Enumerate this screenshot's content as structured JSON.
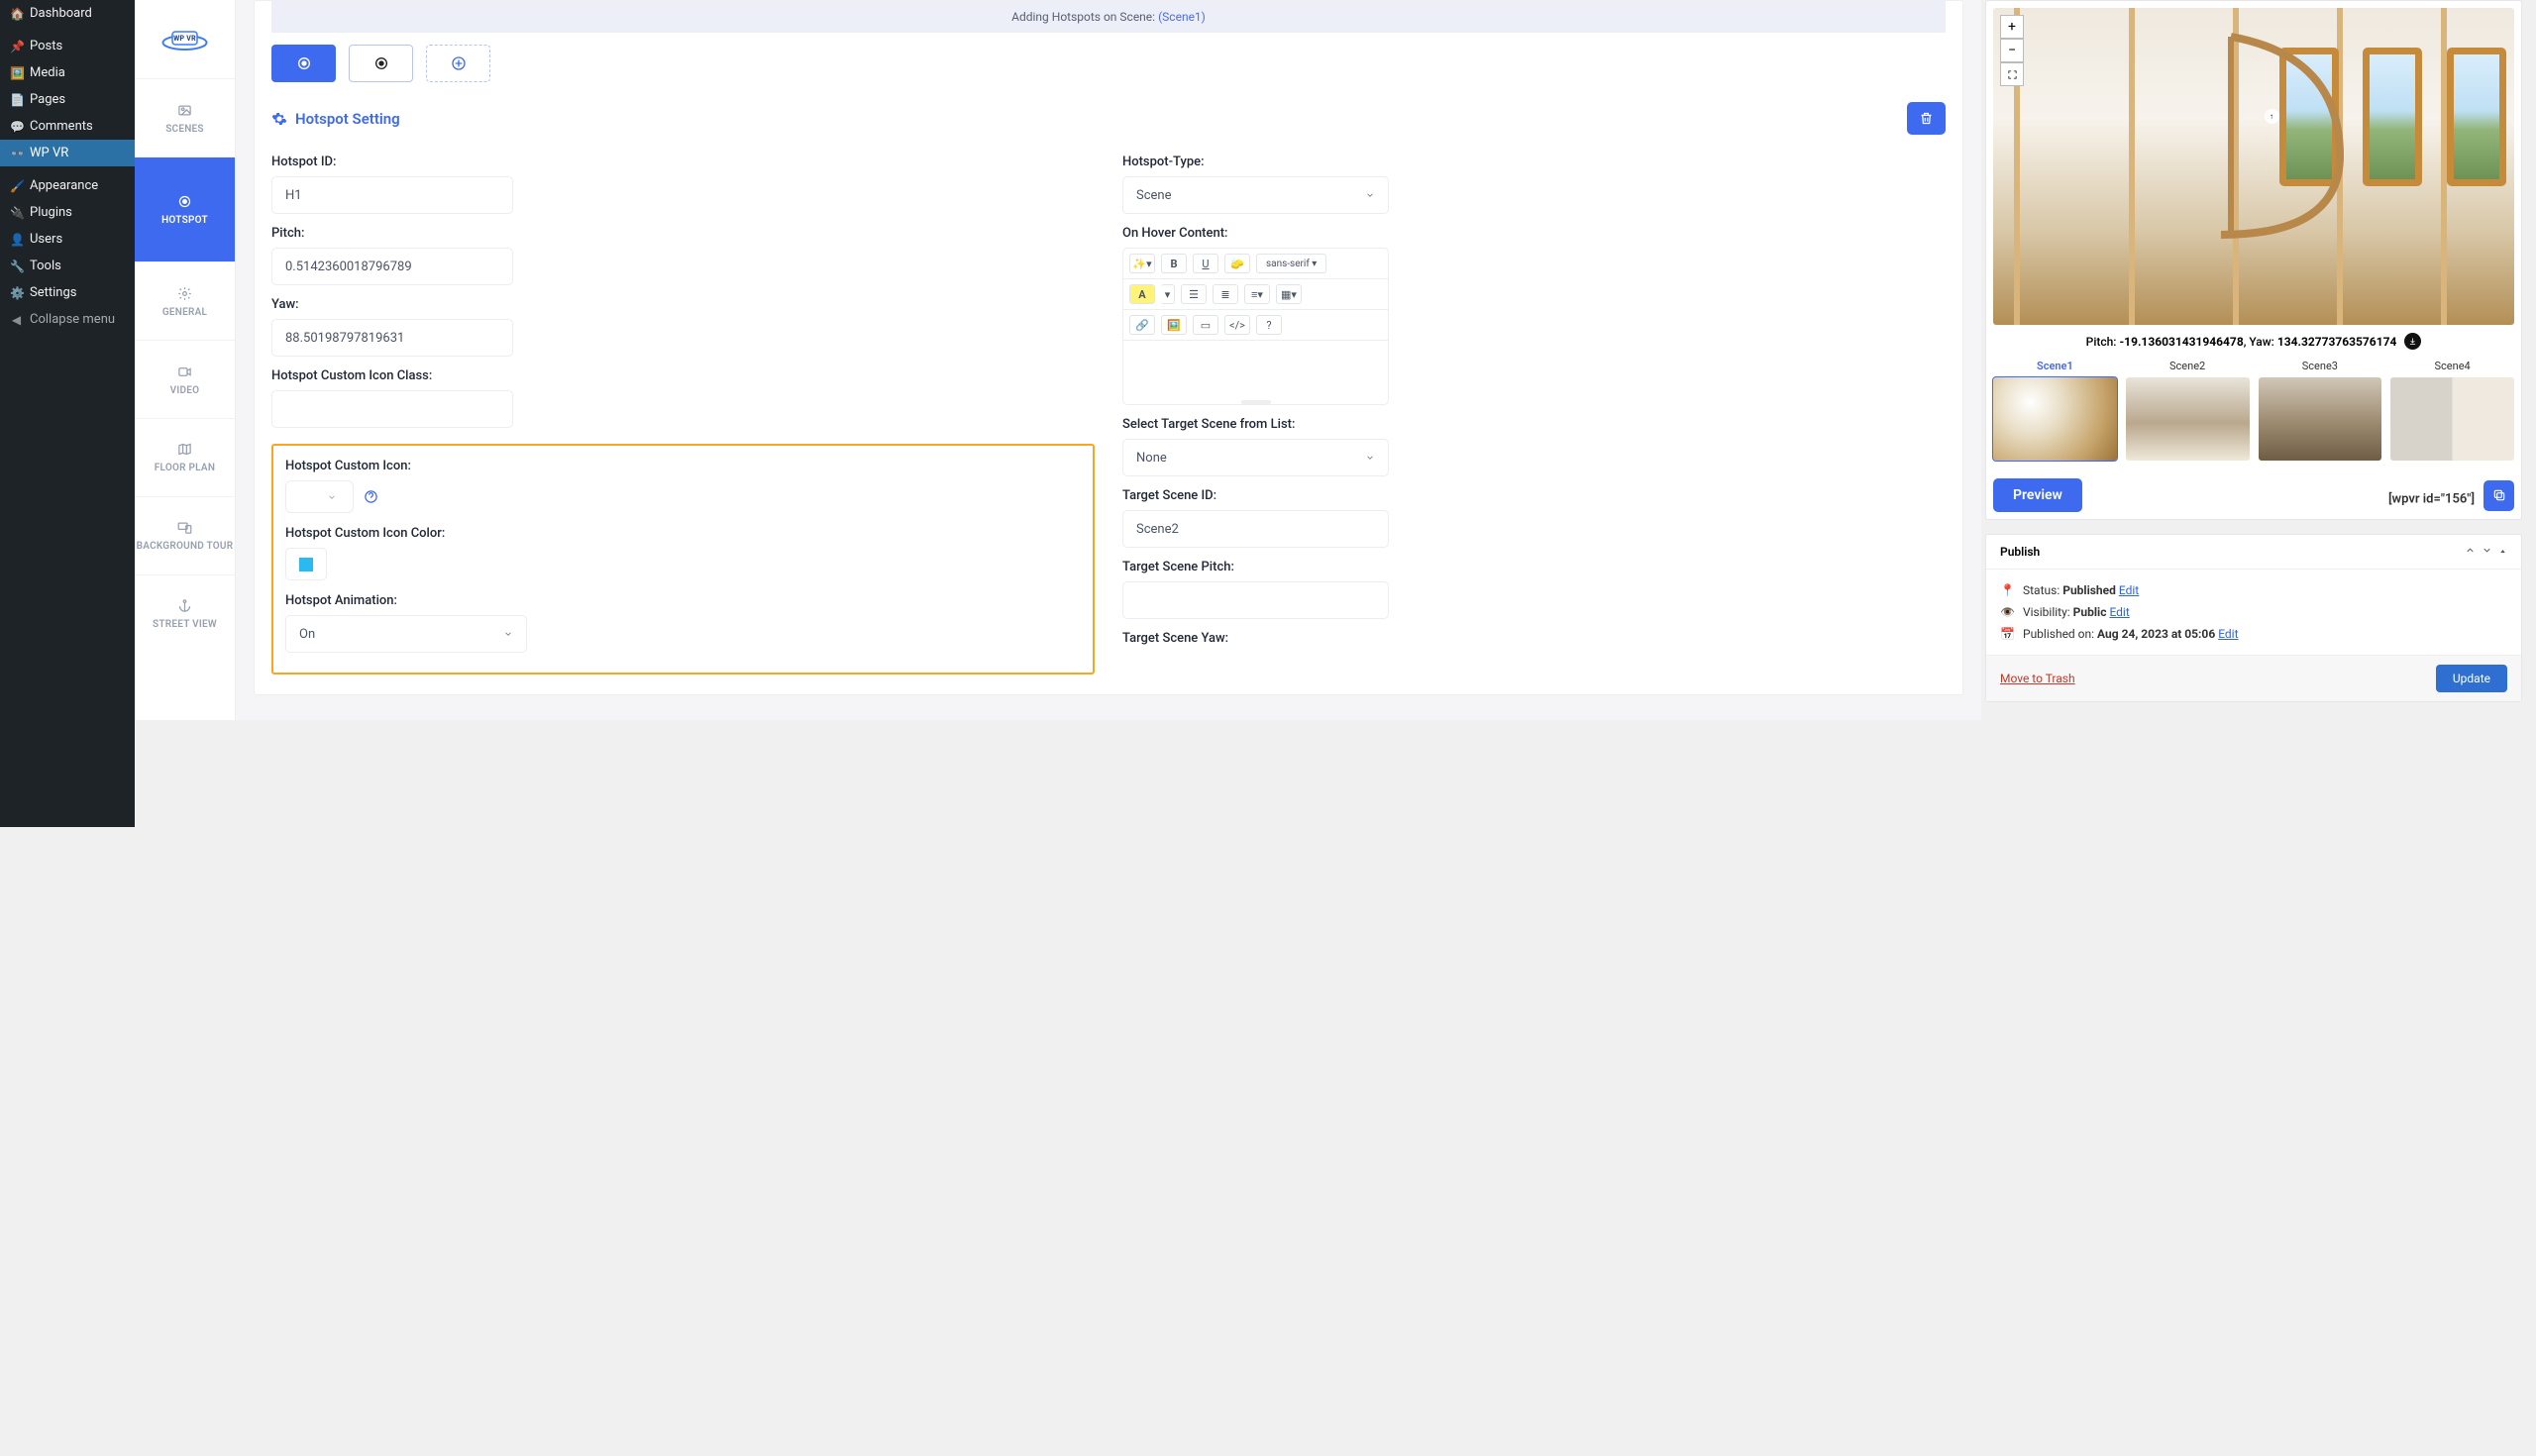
{
  "wp_sidebar": {
    "items": [
      {
        "label": "Dashboard"
      },
      {
        "label": "Posts"
      },
      {
        "label": "Media"
      },
      {
        "label": "Pages"
      },
      {
        "label": "Comments"
      },
      {
        "label": "WP VR"
      },
      {
        "label": "Appearance"
      },
      {
        "label": "Plugins"
      },
      {
        "label": "Users"
      },
      {
        "label": "Tools"
      },
      {
        "label": "Settings"
      },
      {
        "label": "Collapse menu"
      }
    ]
  },
  "rail": {
    "scenes": "SCENES",
    "hotspot": "HOTSPOT",
    "general": "GENERAL",
    "video": "VIDEO",
    "floorplan": "FLOOR PLAN",
    "bgtour": "BACKGROUND TOUR",
    "street": "STREET VIEW"
  },
  "banner": {
    "prefix": "Adding Hotspots on Scene: ",
    "scene": "(Scene1)"
  },
  "setting": {
    "title": "Hotspot Setting"
  },
  "left": {
    "hotspot_id_label": "Hotspot ID:",
    "hotspot_id": "H1",
    "pitch_label": "Pitch:",
    "pitch": "0.5142360018796789",
    "yaw_label": "Yaw:",
    "yaw": "88.50198797819631",
    "icon_class_label": "Hotspot Custom Icon Class:",
    "icon_class": "",
    "icon_label": "Hotspot Custom Icon:",
    "color_label": "Hotspot Custom Icon Color:",
    "color": "#2bbaf0",
    "anim_label": "Hotspot Animation:",
    "anim": "On"
  },
  "right": {
    "type_label": "Hotspot-Type:",
    "type": "Scene",
    "hover_label": "On Hover Content:",
    "font_name": "sans-serif",
    "target_list_label": "Select Target Scene from List:",
    "target_list": "None",
    "target_id_label": "Target Scene ID:",
    "target_id": "Scene2",
    "target_pitch_label": "Target Scene Pitch:",
    "target_pitch": "",
    "target_yaw_label": "Target Scene Yaw:"
  },
  "preview": {
    "pitch_label": "Pitch: ",
    "pitch": "-19.136031431946478",
    "yaw_label": ", Yaw: ",
    "yaw": "134.32773763576174",
    "scenes": [
      "Scene1",
      "Scene2",
      "Scene3",
      "Scene4"
    ],
    "button": "Preview",
    "shortcode": "[wpvr id=\"156\"]"
  },
  "publish": {
    "title": "Publish",
    "status_label": "Status: ",
    "status": "Published",
    "visibility_label": "Visibility: ",
    "visibility": "Public",
    "published_on_label": "Published on: ",
    "published_on": "Aug 24, 2023 at 05:06",
    "edit": "Edit",
    "trash": "Move to Trash",
    "update": "Update"
  }
}
